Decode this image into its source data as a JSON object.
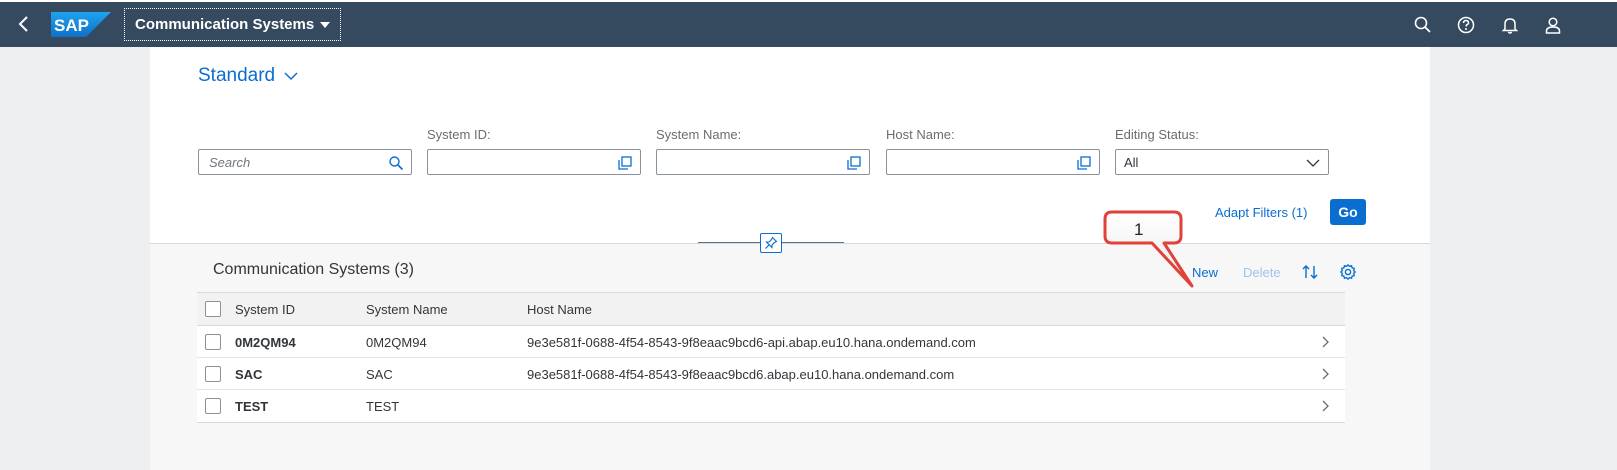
{
  "shell": {
    "logo_text": "SAP",
    "app_title": "Communication Systems",
    "colors": {
      "shell_bg": "#354a5f",
      "accent": "#0a6ed1"
    }
  },
  "filter_bar": {
    "variant": "Standard",
    "search_placeholder": "Search",
    "fields": [
      {
        "label": "System ID:",
        "value": ""
      },
      {
        "label": "System Name:",
        "value": ""
      },
      {
        "label": "Host Name:",
        "value": ""
      },
      {
        "label": "Editing Status:",
        "value": "All"
      }
    ],
    "adapt_filters": "Adapt Filters (1)",
    "go_label": "Go"
  },
  "table": {
    "title": "Communication Systems (3)",
    "toolbar": {
      "new_label": "New",
      "delete_label": "Delete"
    },
    "columns": [
      "System ID",
      "System Name",
      "Host Name"
    ],
    "rows": [
      {
        "system_id": "0M2QM94",
        "system_name": "0M2QM94",
        "host_name": "9e3e581f-0688-4f54-8543-9f8eaac9bcd6-api.abap.eu10.hana.ondemand.com"
      },
      {
        "system_id": "SAC",
        "system_name": "SAC",
        "host_name": "9e3e581f-0688-4f54-8543-9f8eaac9bcd6.abap.eu10.hana.ondemand.com"
      },
      {
        "system_id": "TEST",
        "system_name": "TEST",
        "host_name": ""
      }
    ]
  },
  "callout": {
    "number": "1"
  }
}
